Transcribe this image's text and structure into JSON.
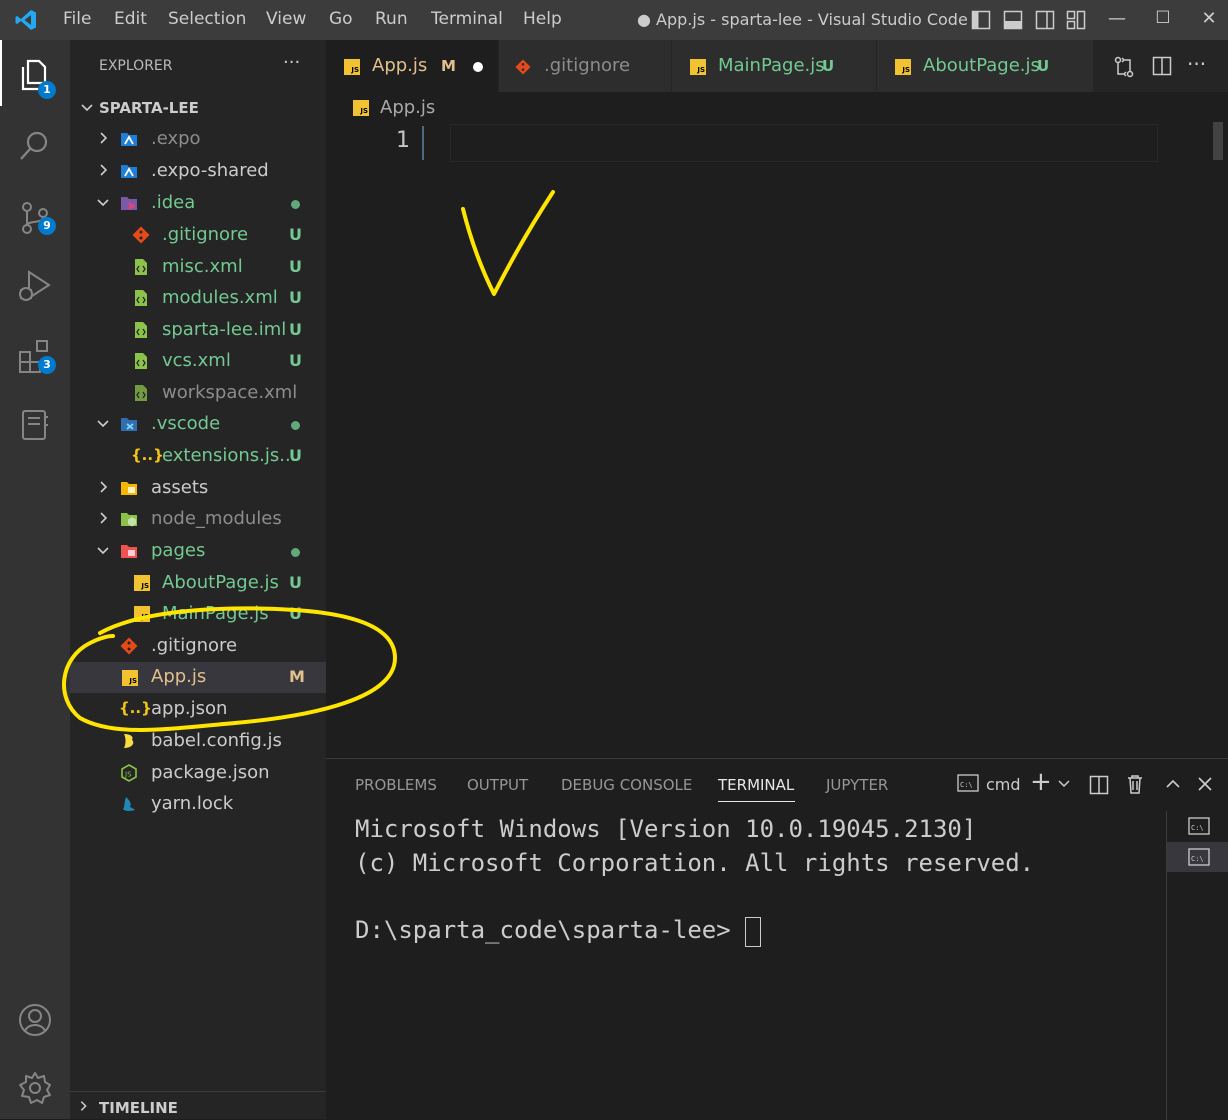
{
  "titlebar": {
    "menu": [
      "File",
      "Edit",
      "Selection",
      "View",
      "Go",
      "Run",
      "Terminal",
      "Help"
    ],
    "title": "● App.js - sparta-lee - Visual Studio Code"
  },
  "activity": {
    "explorer_badge": "1",
    "scm_badge": "9",
    "extensions_badge": "3"
  },
  "explorer": {
    "header": "EXPLORER",
    "more": "···",
    "root": "SPARTA-LEE",
    "items": [
      {
        "label": ".expo",
        "status": ""
      },
      {
        "label": ".expo-shared",
        "status": ""
      },
      {
        "label": ".idea",
        "status": "●"
      },
      {
        "label": ".gitignore",
        "status": "U"
      },
      {
        "label": "misc.xml",
        "status": "U"
      },
      {
        "label": "modules.xml",
        "status": "U"
      },
      {
        "label": "sparta-lee.iml",
        "status": "U"
      },
      {
        "label": "vcs.xml",
        "status": "U"
      },
      {
        "label": "workspace.xml",
        "status": ""
      },
      {
        "label": ".vscode",
        "status": "●"
      },
      {
        "label": "extensions.js...",
        "status": "U"
      },
      {
        "label": "assets",
        "status": ""
      },
      {
        "label": "node_modules",
        "status": ""
      },
      {
        "label": "pages",
        "status": "●"
      },
      {
        "label": "AboutPage.js",
        "status": "U"
      },
      {
        "label": "MainPage.js",
        "status": "U"
      },
      {
        "label": ".gitignore",
        "status": ""
      },
      {
        "label": "App.js",
        "status": "M"
      },
      {
        "label": "app.json",
        "status": ""
      },
      {
        "label": "babel.config.js",
        "status": ""
      },
      {
        "label": "package.json",
        "status": ""
      },
      {
        "label": "yarn.lock",
        "status": ""
      }
    ],
    "timeline": "TIMELINE"
  },
  "tabs": [
    {
      "label": "App.js",
      "status": "M"
    },
    {
      "label": ".gitignore",
      "status": ""
    },
    {
      "label": "MainPage.js",
      "status": "U"
    },
    {
      "label": "AboutPage.js",
      "status": "U"
    }
  ],
  "editor": {
    "breadcrumb": "App.js",
    "line_number": "1"
  },
  "panel": {
    "tabs": [
      "PROBLEMS",
      "OUTPUT",
      "DEBUG CONSOLE",
      "TERMINAL",
      "JUPYTER"
    ],
    "active_tab": "TERMINAL",
    "shell": "cmd",
    "terminal_lines": [
      "Microsoft Windows [Version 10.0.19045.2130]",
      "(c) Microsoft Corporation. All rights reserved.",
      "",
      "D:\\sparta_code\\sparta-lee>"
    ]
  },
  "colors": {
    "annotation": "#ffe500",
    "accent": "#007acc",
    "untracked": "#73c991",
    "modified": "#e2c08d"
  }
}
